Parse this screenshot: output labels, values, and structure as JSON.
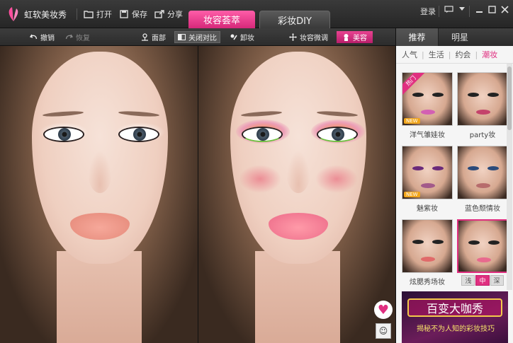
{
  "app": {
    "name": "虹软美妆秀"
  },
  "titlebar": {
    "open": "打开",
    "save": "保存",
    "share": "分享",
    "tab_active": "妆容荟萃",
    "tab_inactive": "彩妆DIY",
    "login": "登录",
    "icons": [
      "folder-icon",
      "save-icon",
      "share-icon",
      "message-icon",
      "dropdown-icon",
      "minimize-icon",
      "maximize-icon",
      "close-icon"
    ]
  },
  "toolbar": {
    "undo": "撤销",
    "redo": "恢复",
    "face": "面部",
    "compare_off": "关闭对比",
    "remove_makeup": "卸妆",
    "fine_tune": "妆容微调",
    "beauty": "美容"
  },
  "panel": {
    "tabs": [
      "推荐",
      "明星"
    ],
    "subtabs": [
      "人气",
      "生活",
      "约会",
      "潮妆"
    ],
    "active_subtab": "潮妆",
    "cards": [
      {
        "label": "洋气雏娃妆",
        "badge": "NEW",
        "ribbon": "热门",
        "lip": "#d35fb3"
      },
      {
        "label": "party妆",
        "badge": "",
        "ribbon": "",
        "lip": "#c4436b"
      },
      {
        "label": "魅紫妆",
        "badge": "NEW",
        "ribbon": "",
        "lip": "#a35a8a"
      },
      {
        "label": "蓝色颓情妆",
        "badge": "",
        "ribbon": "",
        "lip": "#b76c6c"
      },
      {
        "label": "炫腮秀场妆",
        "badge": "",
        "ribbon": "",
        "lip": "#e06a6a"
      },
      {
        "label": "",
        "badge": "",
        "ribbon": "",
        "lip": "#e86a8e",
        "selected": true
      }
    ],
    "levels": [
      "浅",
      "中",
      "深"
    ],
    "active_level": "中",
    "banner": {
      "title": "百变大咖秀",
      "subtitle": "揭秘不为人知的彩妆技巧"
    }
  },
  "colors": {
    "accent": "#e02f80",
    "tab_pink": "#ff5da8",
    "dark_bg": "#262626"
  }
}
